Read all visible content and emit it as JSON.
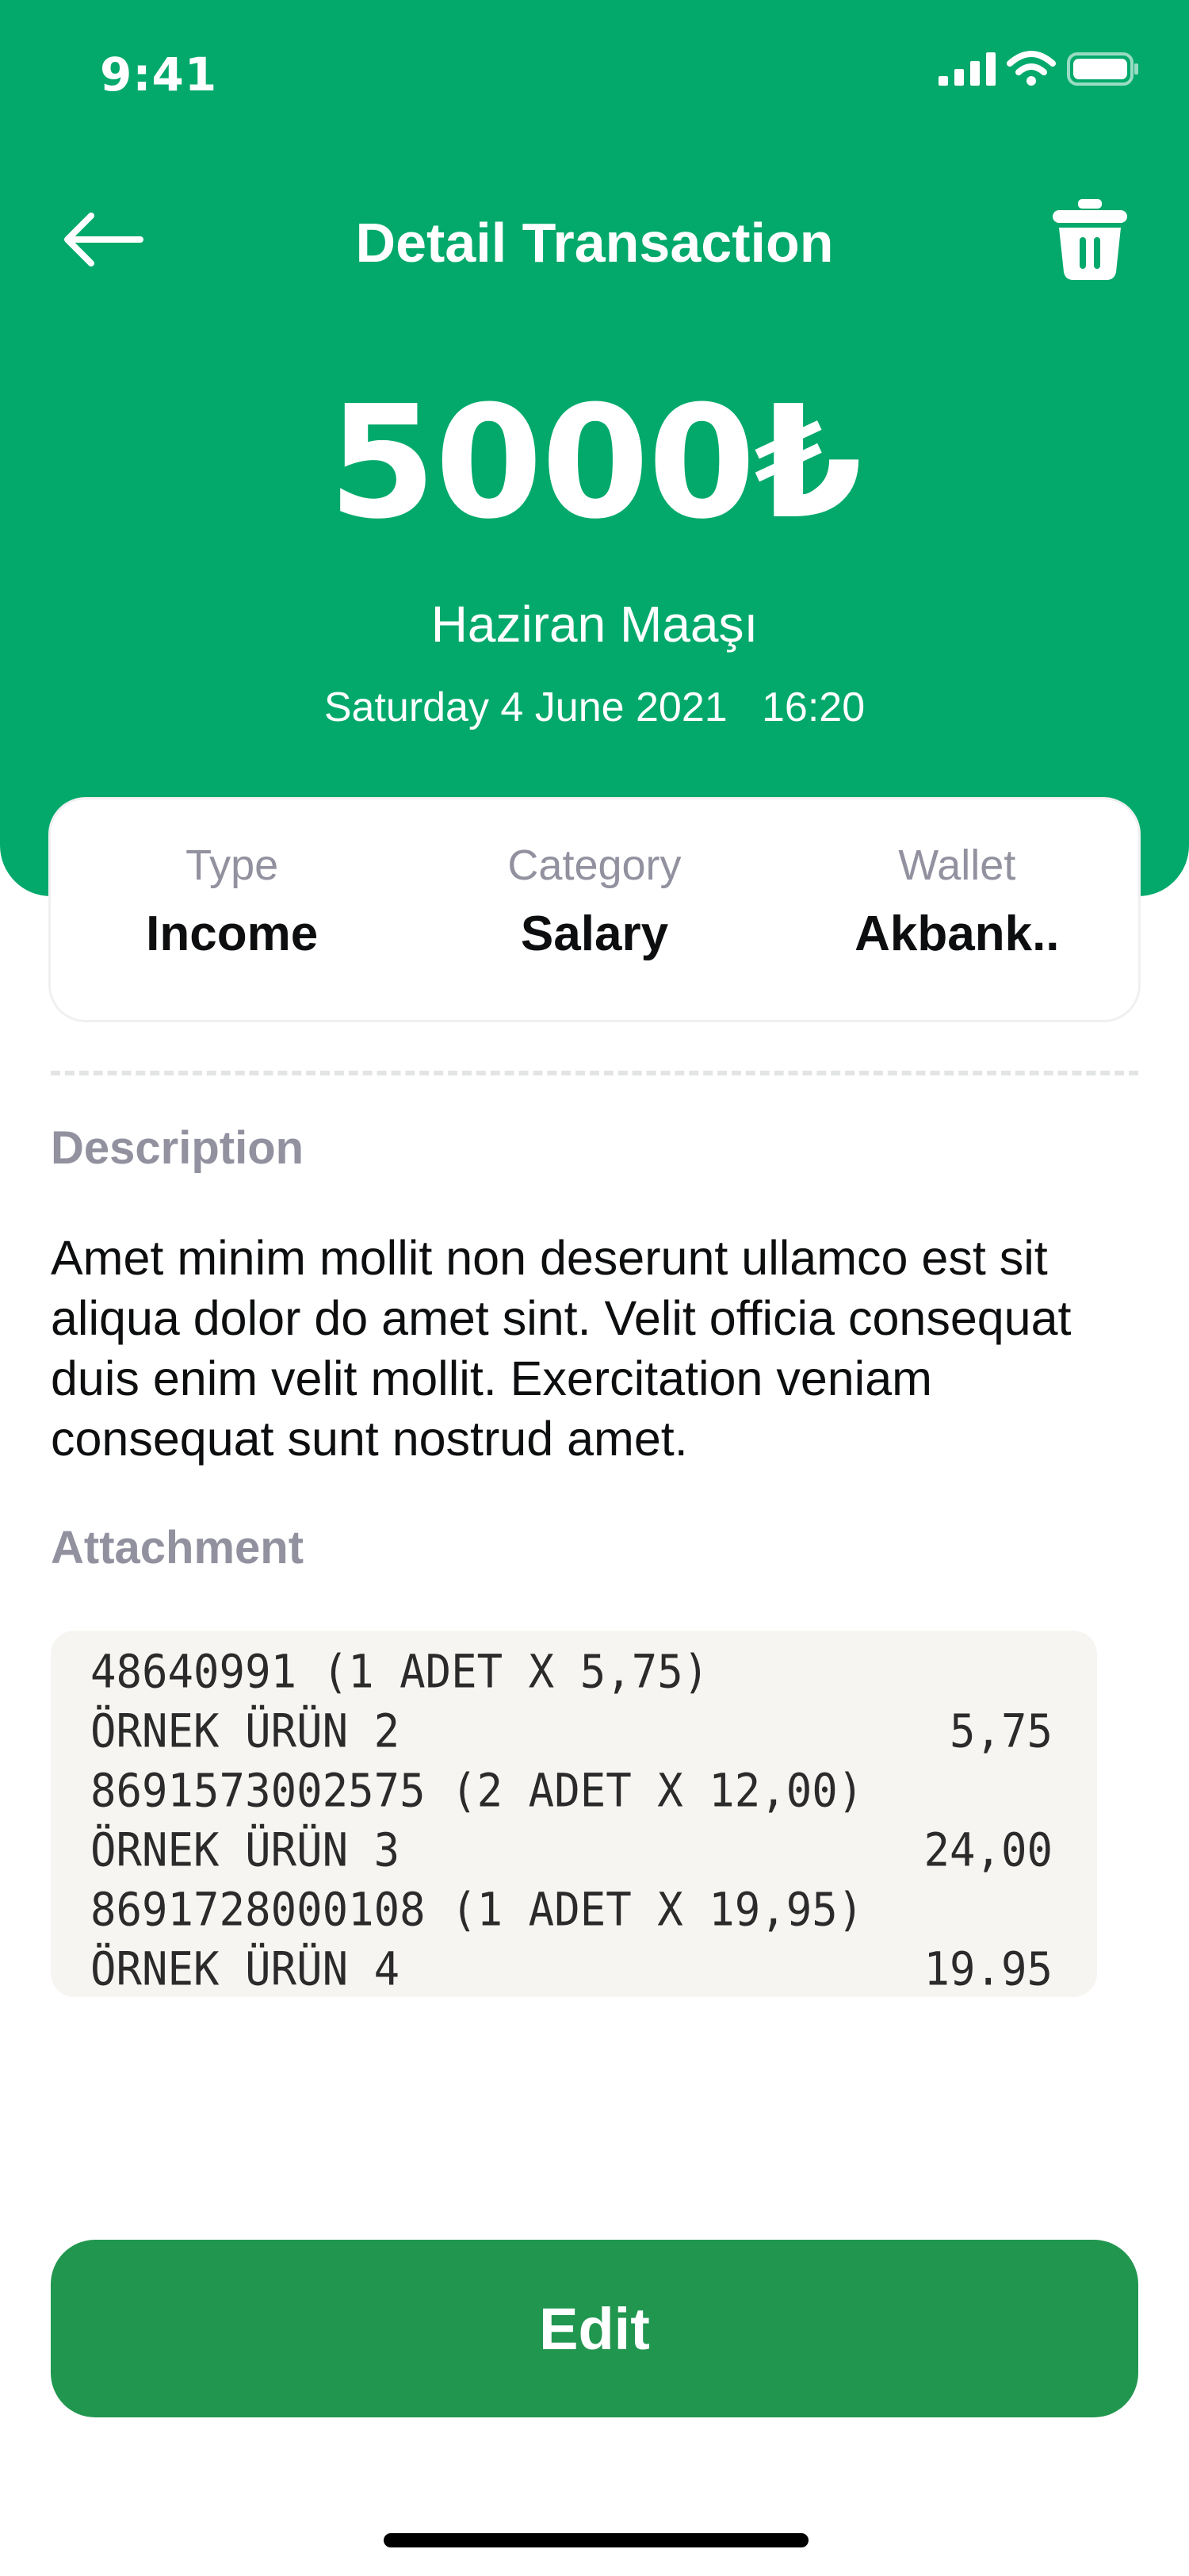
{
  "status_bar": {
    "time": "9:41"
  },
  "header": {
    "title": "Detail Transaction",
    "background_color": "#02A96B",
    "back_icon": "arrow-left-icon",
    "delete_icon": "trash-icon"
  },
  "transaction": {
    "amount": "5000₺",
    "title": "Haziran Maaşı",
    "date": "Saturday 4 June 2021",
    "time": "16:20"
  },
  "summary": [
    {
      "label": "Type",
      "value": "Income"
    },
    {
      "label": "Category",
      "value": "Salary"
    },
    {
      "label": "Wallet",
      "value": "Akbank.."
    }
  ],
  "description": {
    "label": "Description",
    "text": "Amet minim mollit non deserunt ullamco est sit aliqua dolor do amet sint. Velit officia consequat duis enim velit mollit. Exercitation veniam consequat sunt nostrud amet."
  },
  "attachment": {
    "label": "Attachment",
    "receipt_lines": [
      {
        "left": "48640991  (1 ADET X 5,75)",
        "right": ""
      },
      {
        "left": "ÖRNEK ÜRÜN 2",
        "right": "5,75"
      },
      {
        "left": "8691573002575  (2 ADET X 12,00)",
        "right": ""
      },
      {
        "left": "ÖRNEK ÜRÜN 3",
        "right": "24,00"
      },
      {
        "left": "8691728000108  (1 ADET X 19,95)",
        "right": ""
      },
      {
        "left": "ÖRNEK ÜRÜN 4",
        "right": "19.95"
      }
    ]
  },
  "actions": {
    "edit_label": "Edit",
    "edit_color": "#21964F"
  }
}
